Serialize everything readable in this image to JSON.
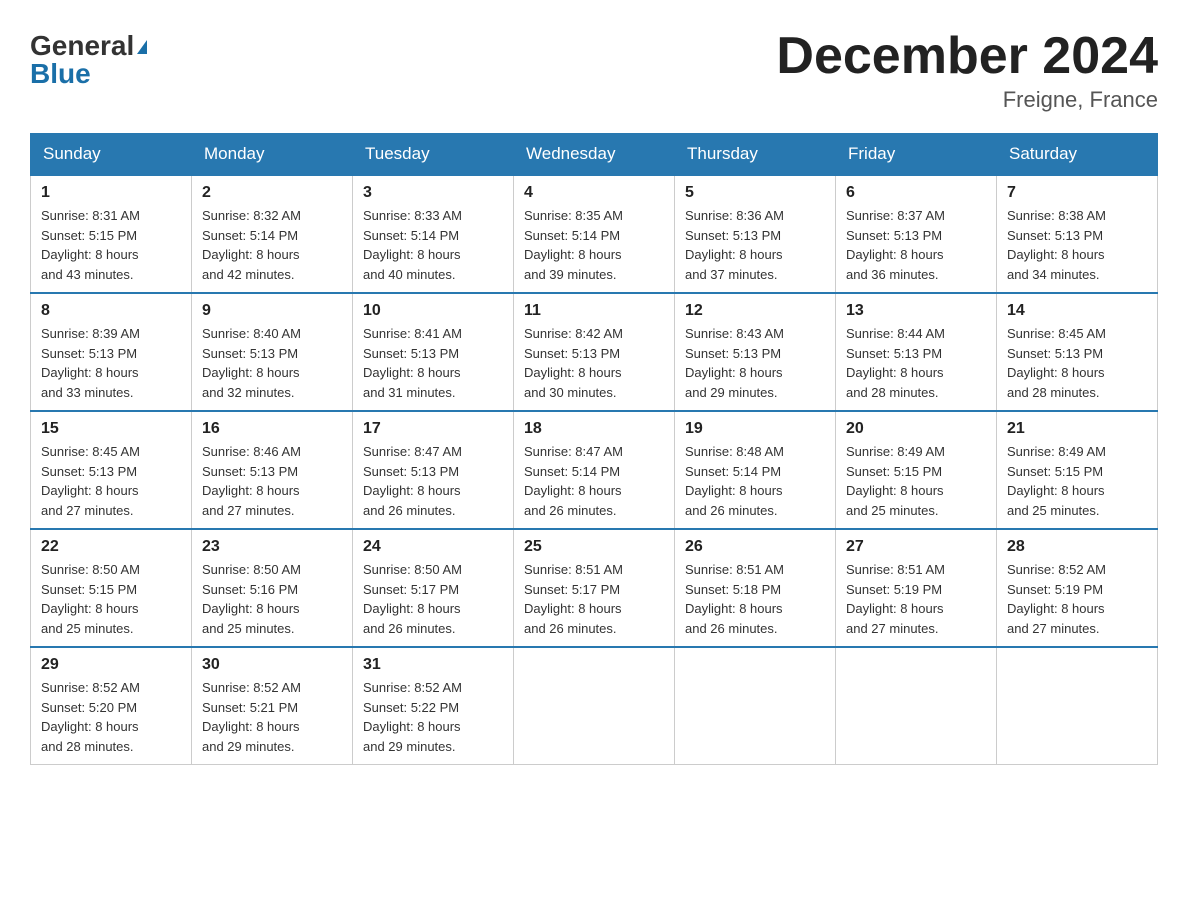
{
  "header": {
    "logo_line1": "General",
    "logo_line2": "Blue",
    "month_year": "December 2024",
    "location": "Freigne, France"
  },
  "days_of_week": [
    "Sunday",
    "Monday",
    "Tuesday",
    "Wednesday",
    "Thursday",
    "Friday",
    "Saturday"
  ],
  "weeks": [
    [
      {
        "day": "1",
        "sunrise": "8:31 AM",
        "sunset": "5:15 PM",
        "daylight": "8 hours and 43 minutes."
      },
      {
        "day": "2",
        "sunrise": "8:32 AM",
        "sunset": "5:14 PM",
        "daylight": "8 hours and 42 minutes."
      },
      {
        "day": "3",
        "sunrise": "8:33 AM",
        "sunset": "5:14 PM",
        "daylight": "8 hours and 40 minutes."
      },
      {
        "day": "4",
        "sunrise": "8:35 AM",
        "sunset": "5:14 PM",
        "daylight": "8 hours and 39 minutes."
      },
      {
        "day": "5",
        "sunrise": "8:36 AM",
        "sunset": "5:13 PM",
        "daylight": "8 hours and 37 minutes."
      },
      {
        "day": "6",
        "sunrise": "8:37 AM",
        "sunset": "5:13 PM",
        "daylight": "8 hours and 36 minutes."
      },
      {
        "day": "7",
        "sunrise": "8:38 AM",
        "sunset": "5:13 PM",
        "daylight": "8 hours and 34 minutes."
      }
    ],
    [
      {
        "day": "8",
        "sunrise": "8:39 AM",
        "sunset": "5:13 PM",
        "daylight": "8 hours and 33 minutes."
      },
      {
        "day": "9",
        "sunrise": "8:40 AM",
        "sunset": "5:13 PM",
        "daylight": "8 hours and 32 minutes."
      },
      {
        "day": "10",
        "sunrise": "8:41 AM",
        "sunset": "5:13 PM",
        "daylight": "8 hours and 31 minutes."
      },
      {
        "day": "11",
        "sunrise": "8:42 AM",
        "sunset": "5:13 PM",
        "daylight": "8 hours and 30 minutes."
      },
      {
        "day": "12",
        "sunrise": "8:43 AM",
        "sunset": "5:13 PM",
        "daylight": "8 hours and 29 minutes."
      },
      {
        "day": "13",
        "sunrise": "8:44 AM",
        "sunset": "5:13 PM",
        "daylight": "8 hours and 28 minutes."
      },
      {
        "day": "14",
        "sunrise": "8:45 AM",
        "sunset": "5:13 PM",
        "daylight": "8 hours and 28 minutes."
      }
    ],
    [
      {
        "day": "15",
        "sunrise": "8:45 AM",
        "sunset": "5:13 PM",
        "daylight": "8 hours and 27 minutes."
      },
      {
        "day": "16",
        "sunrise": "8:46 AM",
        "sunset": "5:13 PM",
        "daylight": "8 hours and 27 minutes."
      },
      {
        "day": "17",
        "sunrise": "8:47 AM",
        "sunset": "5:13 PM",
        "daylight": "8 hours and 26 minutes."
      },
      {
        "day": "18",
        "sunrise": "8:47 AM",
        "sunset": "5:14 PM",
        "daylight": "8 hours and 26 minutes."
      },
      {
        "day": "19",
        "sunrise": "8:48 AM",
        "sunset": "5:14 PM",
        "daylight": "8 hours and 26 minutes."
      },
      {
        "day": "20",
        "sunrise": "8:49 AM",
        "sunset": "5:15 PM",
        "daylight": "8 hours and 25 minutes."
      },
      {
        "day": "21",
        "sunrise": "8:49 AM",
        "sunset": "5:15 PM",
        "daylight": "8 hours and 25 minutes."
      }
    ],
    [
      {
        "day": "22",
        "sunrise": "8:50 AM",
        "sunset": "5:15 PM",
        "daylight": "8 hours and 25 minutes."
      },
      {
        "day": "23",
        "sunrise": "8:50 AM",
        "sunset": "5:16 PM",
        "daylight": "8 hours and 25 minutes."
      },
      {
        "day": "24",
        "sunrise": "8:50 AM",
        "sunset": "5:17 PM",
        "daylight": "8 hours and 26 minutes."
      },
      {
        "day": "25",
        "sunrise": "8:51 AM",
        "sunset": "5:17 PM",
        "daylight": "8 hours and 26 minutes."
      },
      {
        "day": "26",
        "sunrise": "8:51 AM",
        "sunset": "5:18 PM",
        "daylight": "8 hours and 26 minutes."
      },
      {
        "day": "27",
        "sunrise": "8:51 AM",
        "sunset": "5:19 PM",
        "daylight": "8 hours and 27 minutes."
      },
      {
        "day": "28",
        "sunrise": "8:52 AM",
        "sunset": "5:19 PM",
        "daylight": "8 hours and 27 minutes."
      }
    ],
    [
      {
        "day": "29",
        "sunrise": "8:52 AM",
        "sunset": "5:20 PM",
        "daylight": "8 hours and 28 minutes."
      },
      {
        "day": "30",
        "sunrise": "8:52 AM",
        "sunset": "5:21 PM",
        "daylight": "8 hours and 29 minutes."
      },
      {
        "day": "31",
        "sunrise": "8:52 AM",
        "sunset": "5:22 PM",
        "daylight": "8 hours and 29 minutes."
      },
      null,
      null,
      null,
      null
    ]
  ],
  "labels": {
    "sunrise": "Sunrise:",
    "sunset": "Sunset:",
    "daylight": "Daylight:"
  }
}
